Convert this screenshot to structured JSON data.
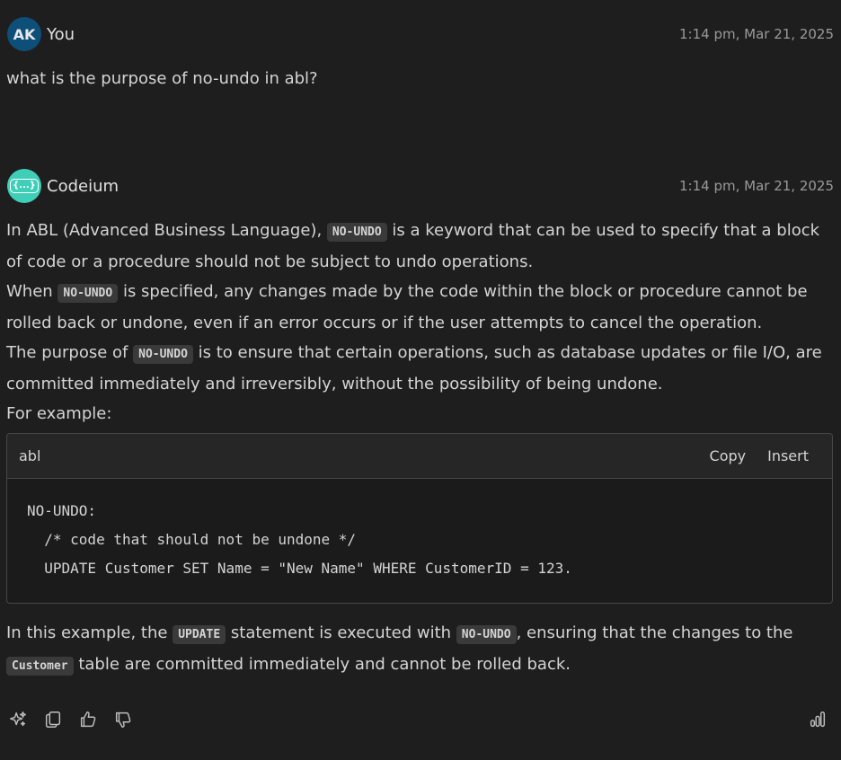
{
  "user_message": {
    "avatar_initials": "AK",
    "sender": "You",
    "timestamp": "1:14 pm, Mar 21, 2025",
    "text": "what is the purpose of no-undo in abl?"
  },
  "assistant_message": {
    "avatar_label": "{...}",
    "sender": "Codeium",
    "timestamp": "1:14 pm, Mar 21, 2025",
    "para1": {
      "t1": "In ABL (Advanced Business Language), ",
      "c1": "NO-UNDO",
      "t2": " is a keyword that can be used to specify that a block of code or a procedure should not be subject to undo operations."
    },
    "para2": {
      "t1": "When ",
      "c1": "NO-UNDO",
      "t2": " is specified, any changes made by the code within the block or procedure cannot be rolled back or undone, even if an error occurs or if the user attempts to cancel the operation."
    },
    "para3": {
      "t1": "The purpose of ",
      "c1": "NO-UNDO",
      "t2": " is to ensure that certain operations, such as database updates or file I/O, are committed immediately and irreversibly, without the possibility of being undone."
    },
    "para4": "For example:",
    "code_block": {
      "language": "abl",
      "copy_label": "Copy",
      "insert_label": "Insert",
      "lines": [
        "NO-UNDO:",
        "  /* code that should not be undone */",
        "  UPDATE Customer SET Name = \"New Name\" WHERE CustomerID = 123."
      ]
    },
    "para5": {
      "t1": "In this example, the ",
      "c1": "UPDATE",
      "t2": " statement is executed with ",
      "c2": "NO-UNDO",
      "t3": ", ensuring that the changes to the ",
      "c3": "Customer",
      "t4": " table are committed immediately and cannot be rolled back."
    }
  },
  "action_icons": [
    "sparkle-icon",
    "copy-icon",
    "thumbs-up-icon",
    "thumbs-down-icon",
    "stats-icon"
  ],
  "colors": {
    "background": "#1e1e1e",
    "user_avatar": "#0e4f7a",
    "assistant_avatar": "#3fcfb8",
    "inline_code_bg": "#3a3a3a"
  }
}
